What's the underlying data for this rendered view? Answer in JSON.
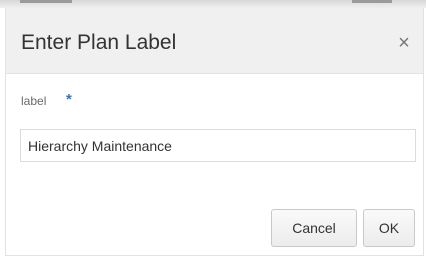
{
  "dialog": {
    "title": "Enter Plan Label",
    "close_icon": "×"
  },
  "form": {
    "label_text": "label",
    "required_marker": "*",
    "label_value": "Hierarchy Maintenance"
  },
  "buttons": {
    "cancel_label": "Cancel",
    "ok_label": "OK"
  },
  "colors": {
    "header_bg": "#f0f0f0",
    "required_accent": "#2a78c8"
  }
}
